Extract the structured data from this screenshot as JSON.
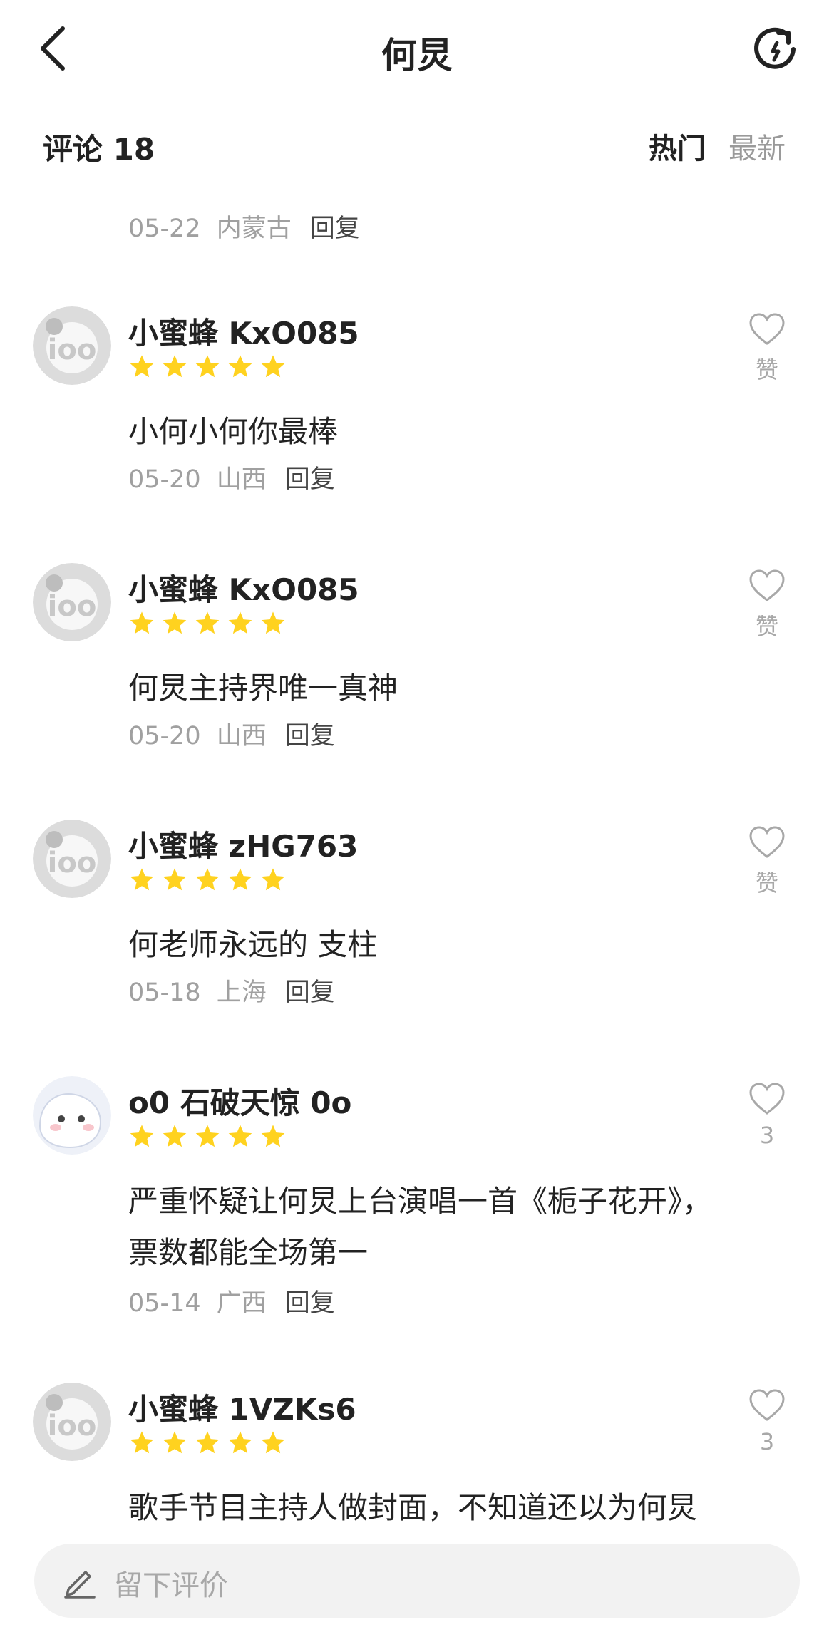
{
  "header": {
    "title": "何炅"
  },
  "comments_header": {
    "count_label": "评论 18",
    "sort_hot": "热门",
    "sort_new": "最新"
  },
  "prev_meta": {
    "date": "05-22",
    "location": "内蒙古",
    "reply": "回复"
  },
  "comments": [
    {
      "username": "小蜜蜂 KxO085",
      "rating": 5,
      "text": "小何小何你最棒",
      "date": "05-20",
      "location": "山西",
      "reply": "回复",
      "like_label": "赞"
    },
    {
      "username": "小蜜蜂 KxO085",
      "rating": 5,
      "text": "何炅主持界唯一真神",
      "date": "05-20",
      "location": "山西",
      "reply": "回复",
      "like_label": "赞"
    },
    {
      "username": "小蜜蜂 zHG763",
      "rating": 5,
      "text": "何老师永远的 支柱",
      "date": "05-18",
      "location": "上海",
      "reply": "回复",
      "like_label": "赞"
    },
    {
      "username": "o0 石破天惊 0o",
      "rating": 5,
      "text": "严重怀疑让何炅上台演唱一首《栀子花开》，票数都能全场第一",
      "date": "05-14",
      "location": "广西",
      "reply": "回复",
      "like_label": "3"
    },
    {
      "username": "小蜜蜂 1VZKs6",
      "rating": 5,
      "text": "歌手节目主持人做封面，不知道还以为何炅去参赛了",
      "like_label": "3"
    }
  ],
  "composer": {
    "placeholder": "留下评价"
  },
  "colors": {
    "star": "#FFD21F",
    "muted": "#a0a0a0",
    "input_bg": "#f2f2f2"
  }
}
